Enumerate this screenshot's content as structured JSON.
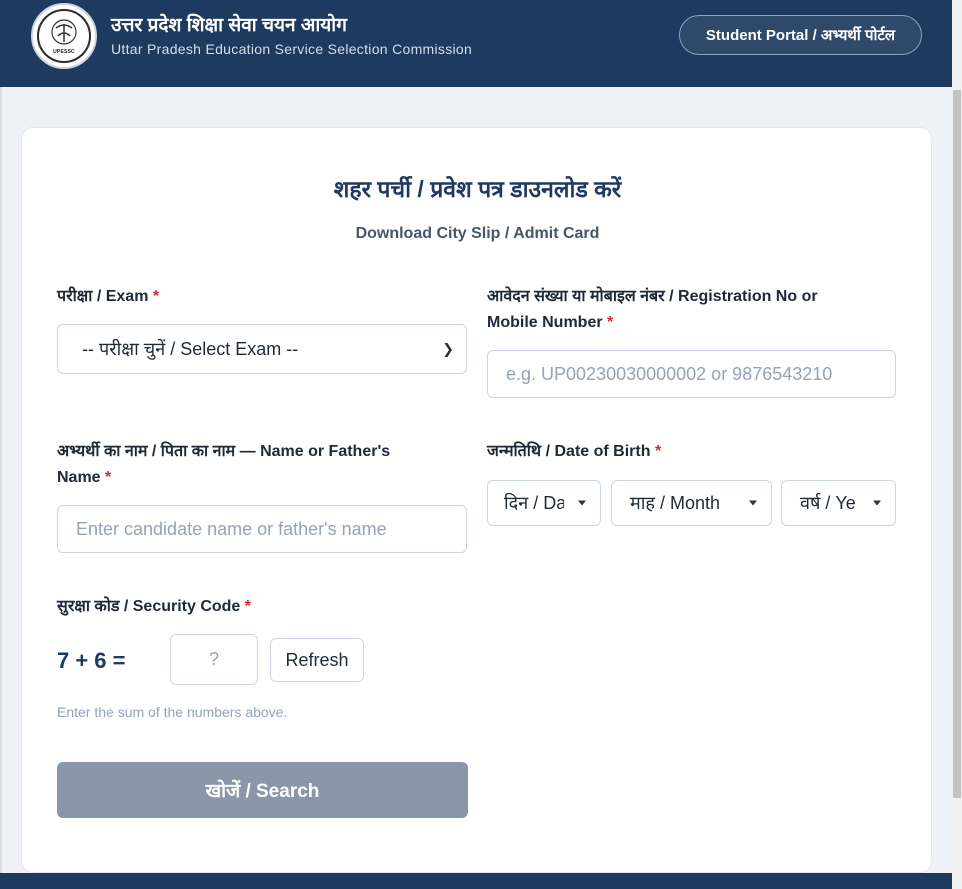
{
  "header": {
    "title_hi": "उत्तर प्रदेश शिक्षा सेवा चयन आयोग",
    "title_en": "Uttar Pradesh Education Service Selection Commission",
    "logo_text": "UPESSC",
    "portal_button": "Student Portal / अभ्यर्थी पोर्टल"
  },
  "form": {
    "title": "शहर पर्ची / प्रवेश पत्र डाउनलोड करें",
    "subtitle": "Download City Slip / Admit Card",
    "required_mark": "*",
    "exam": {
      "label": "परीक्षा / Exam",
      "selected": "-- परीक्षा चुनें / Select Exam --"
    },
    "registration": {
      "label_line1": "आवेदन संख्या या मोबाइल नंबर / Registration No or",
      "label_line2": "Mobile Number",
      "placeholder": "e.g. UP00230030000002 or 9876543210"
    },
    "name": {
      "label_line1": "अभ्यर्थी का नाम / पिता का नाम — Name or Father's",
      "label_line2": "Name",
      "placeholder": "Enter candidate name or father's name"
    },
    "dob": {
      "label": "जन्मतिथि / Date of Birth",
      "day": "दिन / Da",
      "month": "माह / Month",
      "year": "वर्ष / Ye"
    },
    "security": {
      "label": "सुरक्षा कोड / Security Code",
      "question": "7 + 6 =",
      "answer_placeholder": "?",
      "refresh": "Refresh",
      "hint": "Enter the sum of the numbers above."
    },
    "search_button": "खोजें / Search"
  }
}
